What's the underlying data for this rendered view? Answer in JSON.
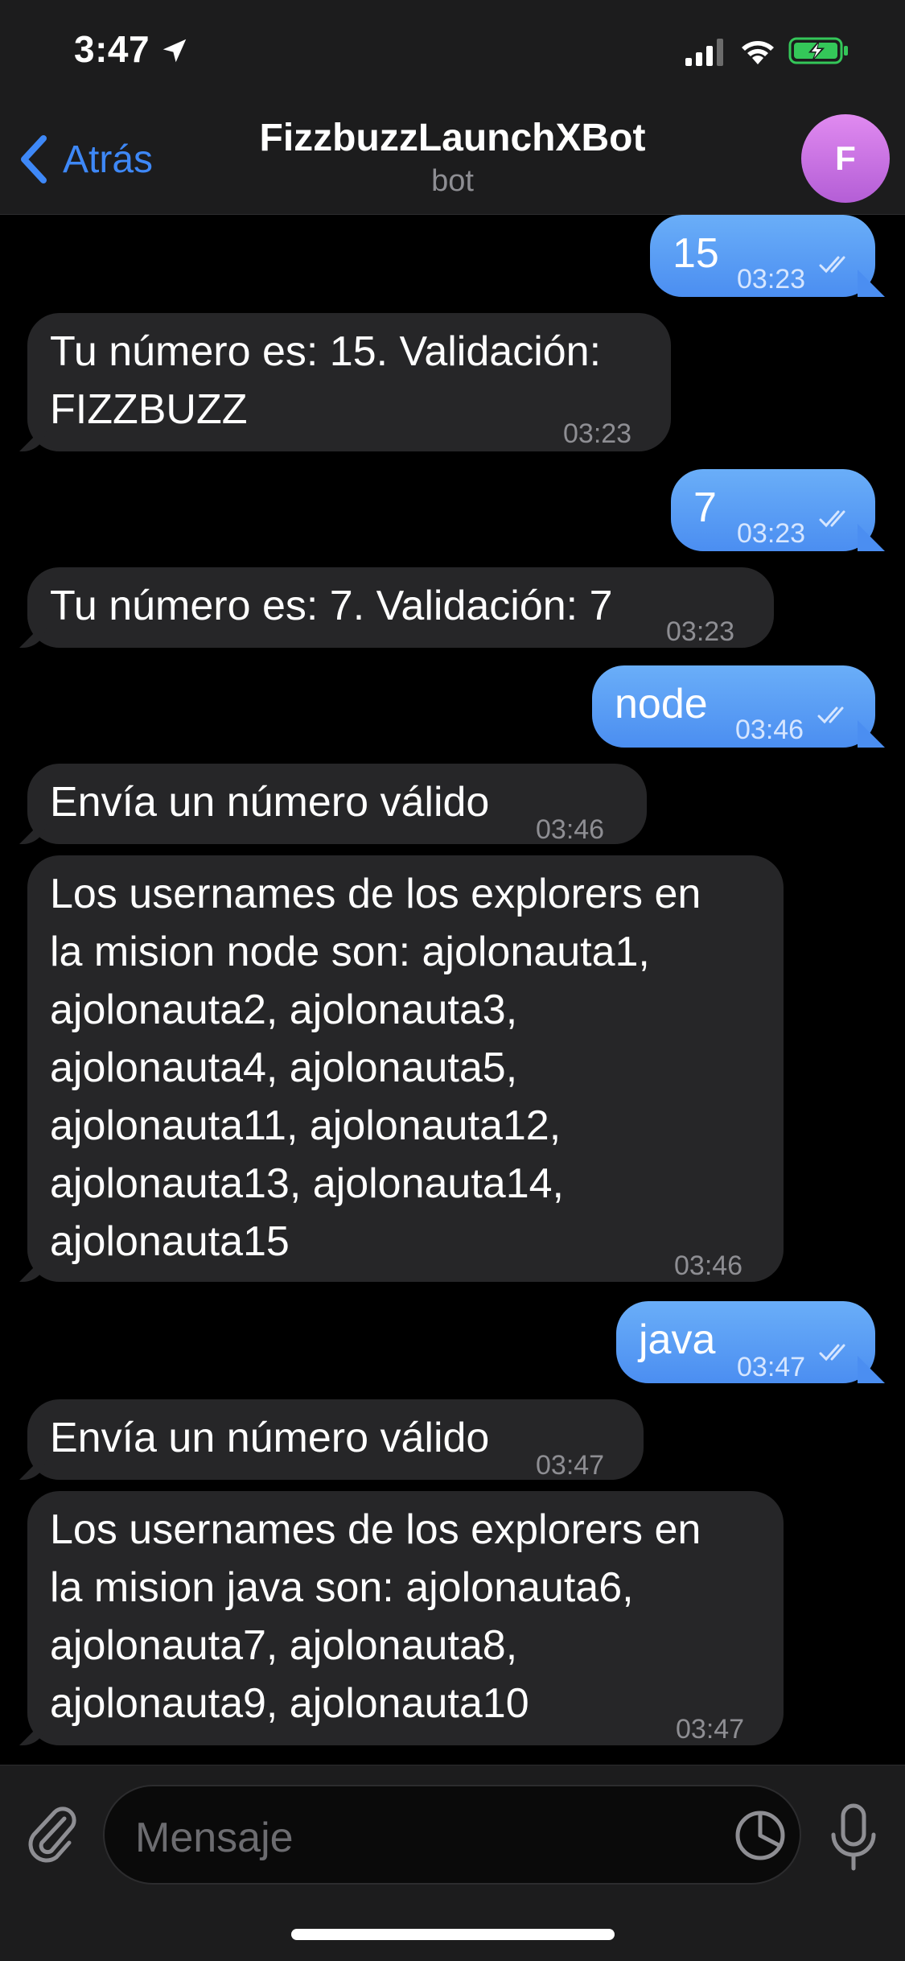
{
  "status_bar": {
    "time": "3:47"
  },
  "header": {
    "back_label": "Atrás",
    "title": "FizzbuzzLaunchXBot",
    "subtitle": "bot",
    "avatar_letter": "F"
  },
  "messages": [
    {
      "dir": "out",
      "text": "15",
      "time": "03:23"
    },
    {
      "dir": "in",
      "text": "Tu número es: 15. Validación:\nFIZZBUZZ",
      "time": "03:23"
    },
    {
      "dir": "out",
      "text": "7",
      "time": "03:23"
    },
    {
      "dir": "in",
      "text": "Tu número es: 7. Validación: 7",
      "time": "03:23"
    },
    {
      "dir": "out",
      "text": "node",
      "time": "03:46"
    },
    {
      "dir": "in",
      "text": "Envía un número válido",
      "time": "03:46"
    },
    {
      "dir": "in",
      "text": "Los usernames de los explorers en\nla mision node son: ajolonauta1,\najolonauta2, ajolonauta3,\najolonauta4, ajolonauta5,\najolonauta11, ajolonauta12,\najolonauta13, ajolonauta14,\najolonauta15",
      "time": "03:46"
    },
    {
      "dir": "out",
      "text": "java",
      "time": "03:47"
    },
    {
      "dir": "in",
      "text": "Envía un número válido",
      "time": "03:47"
    },
    {
      "dir": "in",
      "text": "Los usernames de los explorers en\nla mision java son: ajolonauta6,\najolonauta7, ajolonauta8,\najolonauta9, ajolonauta10",
      "time": "03:47"
    }
  ],
  "composer": {
    "placeholder": "Mensaje"
  },
  "colors": {
    "accent": "#3e88f7",
    "outgoing": "#4b8ef1",
    "incoming": "#262628",
    "background": "#000000"
  }
}
